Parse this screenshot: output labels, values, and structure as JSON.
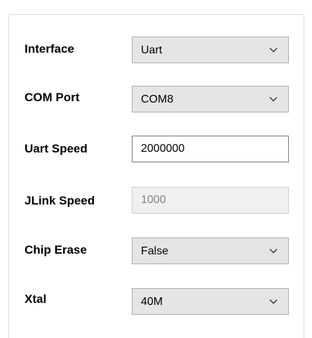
{
  "settings": {
    "interface": {
      "label": "Interface",
      "value": "Uart",
      "icon": "chevron-down-icon"
    },
    "com_port": {
      "label": "COM Port",
      "value": "COM8",
      "icon": "chevron-down-icon"
    },
    "uart_speed": {
      "label": "Uart Speed",
      "value": "2000000"
    },
    "jlink_speed": {
      "label": "JLink Speed",
      "value": "1000",
      "disabled": true
    },
    "chip_erase": {
      "label": "Chip Erase",
      "value": "False",
      "icon": "chevron-down-icon"
    },
    "xtal": {
      "label": "Xtal",
      "value": "40M",
      "icon": "chevron-down-icon"
    }
  },
  "colors": {
    "combo_background": "#e5e5e5",
    "combo_border": "#adadad",
    "textbox_border": "#7a7a7a",
    "disabled_background": "#f0f0f0",
    "disabled_text": "#838383"
  }
}
